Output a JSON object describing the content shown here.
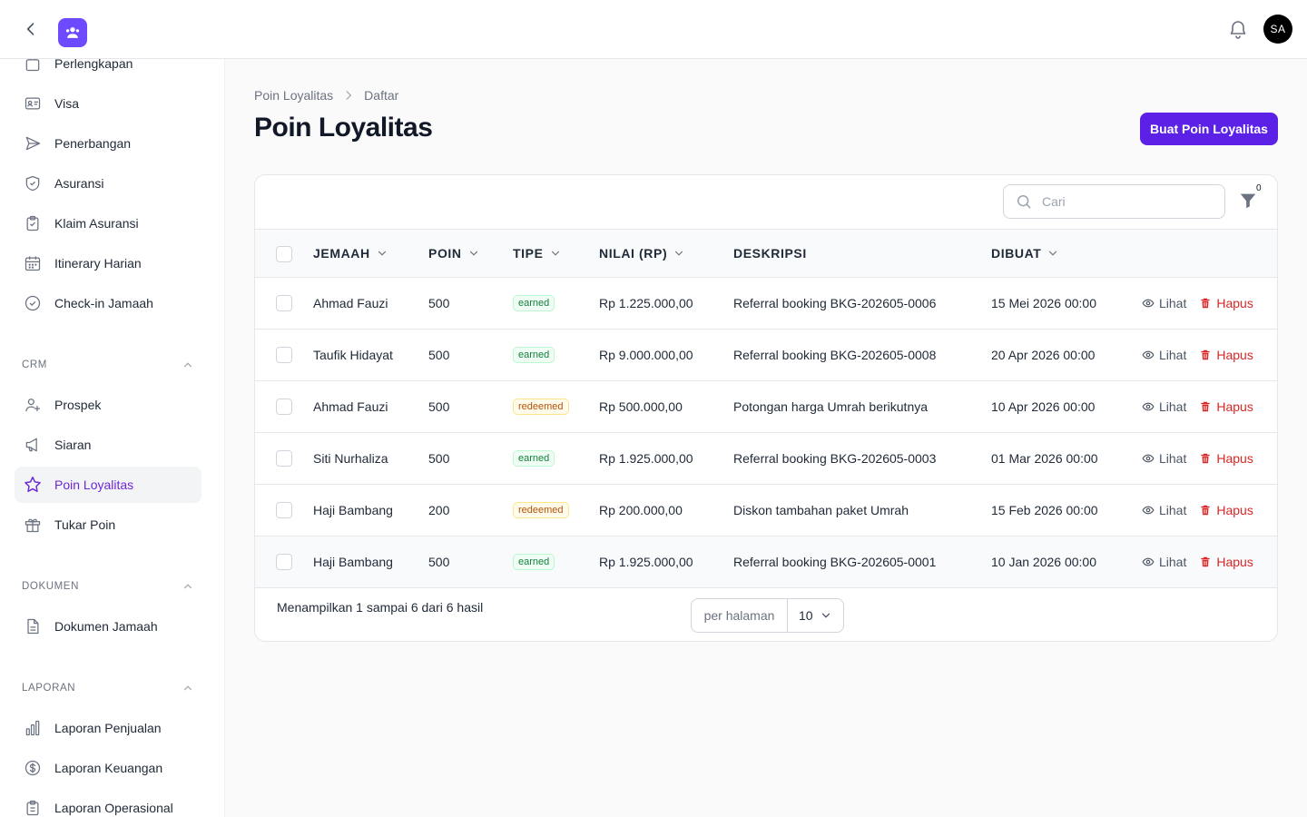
{
  "topbar": {
    "avatar_initials": "SA"
  },
  "sidebar": {
    "items_top": [
      {
        "label": "Perlengkapan",
        "icon": "bag-icon"
      },
      {
        "label": "Visa",
        "icon": "id-card-icon"
      },
      {
        "label": "Penerbangan",
        "icon": "paper-plane-icon"
      },
      {
        "label": "Asuransi",
        "icon": "shield-icon"
      },
      {
        "label": "Klaim Asuransi",
        "icon": "clipboard-check-icon"
      },
      {
        "label": "Itinerary Harian",
        "icon": "calendar-icon"
      },
      {
        "label": "Check-in Jamaah",
        "icon": "check-circle-icon"
      }
    ],
    "groups": {
      "crm": "CRM",
      "dokumen": "DOKUMEN",
      "laporan": "LAPORAN"
    },
    "crm_items": [
      {
        "label": "Prospek",
        "icon": "user-plus-icon"
      },
      {
        "label": "Siaran",
        "icon": "megaphone-icon"
      },
      {
        "label": "Poin Loyalitas",
        "icon": "star-icon",
        "active": true
      },
      {
        "label": "Tukar Poin",
        "icon": "gift-icon"
      }
    ],
    "dokumen_items": [
      {
        "label": "Dokumen Jamaah",
        "icon": "document-icon"
      }
    ],
    "laporan_items": [
      {
        "label": "Laporan Penjualan",
        "icon": "bar-chart-icon"
      },
      {
        "label": "Laporan Keuangan",
        "icon": "dollar-circle-icon"
      },
      {
        "label": "Laporan Operasional",
        "icon": "clipboard-icon"
      }
    ]
  },
  "breadcrumb": {
    "parent": "Poin Loyalitas",
    "current": "Daftar"
  },
  "page": {
    "title": "Poin Loyalitas",
    "create_button": "Buat Poin Loyalitas"
  },
  "search": {
    "placeholder": "Cari"
  },
  "filter": {
    "count": "0"
  },
  "table": {
    "columns": [
      "JEMAAH",
      "POIN",
      "TIPE",
      "NILAI (RP)",
      "DESKRIPSI",
      "DIBUAT"
    ],
    "view_label": "Lihat",
    "delete_label": "Hapus",
    "rows": [
      {
        "jemaah": "Ahmad Fauzi",
        "poin": "500",
        "tipe": "earned",
        "nilai": "Rp 1.225.000,00",
        "deskripsi": "Referral booking BKG-202605-0006",
        "dibuat": "15 Mei 2026 00:00"
      },
      {
        "jemaah": "Taufik Hidayat",
        "poin": "500",
        "tipe": "earned",
        "nilai": "Rp 9.000.000,00",
        "deskripsi": "Referral booking BKG-202605-0008",
        "dibuat": "20 Apr 2026 00:00"
      },
      {
        "jemaah": "Ahmad Fauzi",
        "poin": "500",
        "tipe": "redeemed",
        "nilai": "Rp 500.000,00",
        "deskripsi": "Potongan harga Umrah berikutnya",
        "dibuat": "10 Apr 2026 00:00"
      },
      {
        "jemaah": "Siti Nurhaliza",
        "poin": "500",
        "tipe": "earned",
        "nilai": "Rp 1.925.000,00",
        "deskripsi": "Referral booking BKG-202605-0003",
        "dibuat": "01 Mar 2026 00:00"
      },
      {
        "jemaah": "Haji Bambang",
        "poin": "200",
        "tipe": "redeemed",
        "nilai": "Rp 200.000,00",
        "deskripsi": "Diskon tambahan paket Umrah",
        "dibuat": "15 Feb 2026 00:00"
      },
      {
        "jemaah": "Haji Bambang",
        "poin": "500",
        "tipe": "earned",
        "nilai": "Rp 1.925.000,00",
        "deskripsi": "Referral booking BKG-202605-0001",
        "dibuat": "10 Jan 2026 00:00"
      }
    ]
  },
  "pagination": {
    "summary": "Menampilkan 1 sampai 6 dari 6 hasil",
    "per_page_label": "per halaman",
    "per_page_value": "10"
  }
}
